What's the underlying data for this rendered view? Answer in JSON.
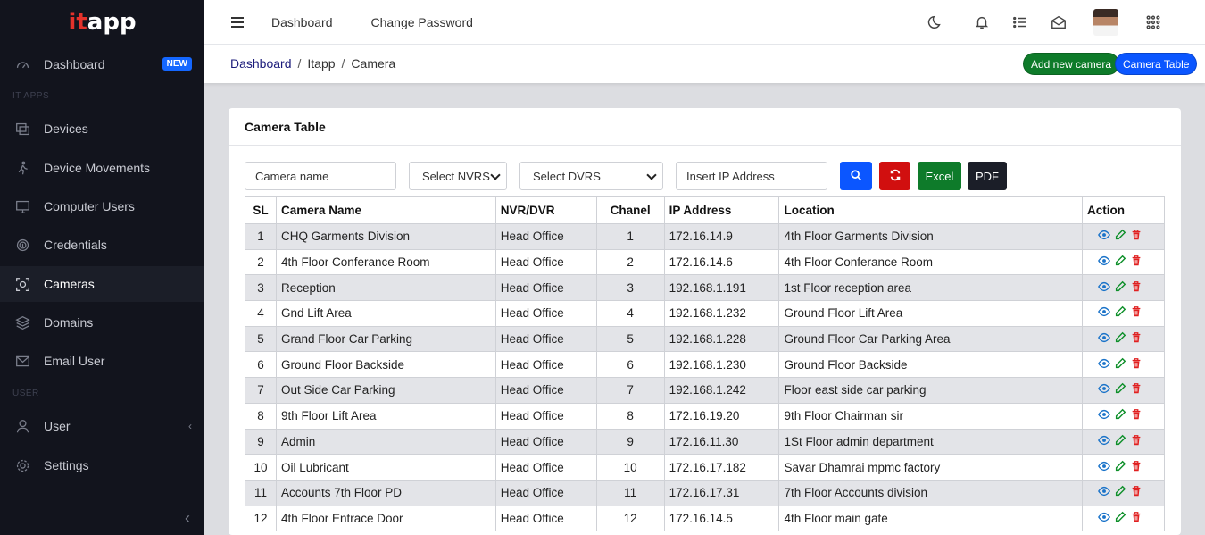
{
  "brand": {
    "part1": "it",
    "part2": "app"
  },
  "sidebar": {
    "items": [
      {
        "key": "dashboard",
        "label": "Dashboard",
        "badge": "NEW"
      },
      {
        "key": "devices",
        "label": "Devices"
      },
      {
        "key": "device-movements",
        "label": "Device Movements"
      },
      {
        "key": "computer-users",
        "label": "Computer Users"
      },
      {
        "key": "credentials",
        "label": "Credentials"
      },
      {
        "key": "cameras",
        "label": "Cameras"
      },
      {
        "key": "domains",
        "label": "Domains"
      },
      {
        "key": "email-user",
        "label": "Email User"
      },
      {
        "key": "user",
        "label": "User"
      },
      {
        "key": "settings",
        "label": "Settings"
      }
    ],
    "sections": {
      "apps": "IT APPS",
      "user": "USER"
    }
  },
  "topbar": {
    "dashboard": "Dashboard",
    "change_password": "Change Password"
  },
  "breadcrumb": {
    "home": "Dashboard",
    "level2": "Itapp",
    "current": "Camera"
  },
  "actions": {
    "add_camera": "Add new camera",
    "camera_table": "Camera Table"
  },
  "card": {
    "title": "Camera Table"
  },
  "filters": {
    "camera_name_placeholder": "Camera name",
    "nvrs_select": "Select NVRS",
    "dvrs_select": "Select DVRS",
    "ip_placeholder": "Insert IP Address",
    "excel": "Excel",
    "pdf": "PDF"
  },
  "colors": {
    "sidebar_bg": "#12141d",
    "search_btn": "#0b56ff",
    "reset_btn": "#d10f0f",
    "excel_btn": "#0e7b2a",
    "pdf_btn": "#1b1e28",
    "view_icon": "#1a73c9",
    "edit_icon": "#0e8f2a",
    "delete_icon": "#e02020"
  },
  "table": {
    "headers": [
      "SL",
      "Camera Name",
      "NVR/DVR",
      "Chanel",
      "IP Address",
      "Location",
      "Action"
    ],
    "rows": [
      [
        "1",
        "CHQ Garments Division",
        "Head Office",
        "1",
        "172.16.14.9",
        "4th Floor Garments Division"
      ],
      [
        "2",
        "4th Floor Conferance Room",
        "Head Office",
        "2",
        "172.16.14.6",
        "4th Floor Conferance Room"
      ],
      [
        "3",
        "Reception",
        "Head Office",
        "3",
        "192.168.1.191",
        "1st Floor reception area"
      ],
      [
        "4",
        "Gnd Lift Area",
        "Head Office",
        "4",
        "192.168.1.232",
        "Ground Floor Lift Area"
      ],
      [
        "5",
        "Grand Floor Car Parking",
        "Head Office",
        "5",
        "192.168.1.228",
        "Ground Floor Car Parking Area"
      ],
      [
        "6",
        "Ground Floor Backside",
        "Head Office",
        "6",
        "192.168.1.230",
        "Ground Floor Backside"
      ],
      [
        "7",
        "Out Side Car Parking",
        "Head Office",
        "7",
        "192.168.1.242",
        "Floor east side car parking"
      ],
      [
        "8",
        "9th Floor Lift Area",
        "Head Office",
        "8",
        "172.16.19.20",
        "9th Floor Chairman sir"
      ],
      [
        "9",
        "Admin",
        "Head Office",
        "9",
        "172.16.11.30",
        "1St Floor admin department"
      ],
      [
        "10",
        "Oil Lubricant",
        "Head Office",
        "10",
        "172.16.17.182",
        "Savar Dhamrai mpmc factory"
      ],
      [
        "11",
        "Accounts 7th Floor PD",
        "Head Office",
        "11",
        "172.16.17.31",
        "7th Floor Accounts division"
      ],
      [
        "12",
        "4th Floor Entrace Door",
        "Head Office",
        "12",
        "172.16.14.5",
        "4th Floor main gate"
      ]
    ]
  }
}
